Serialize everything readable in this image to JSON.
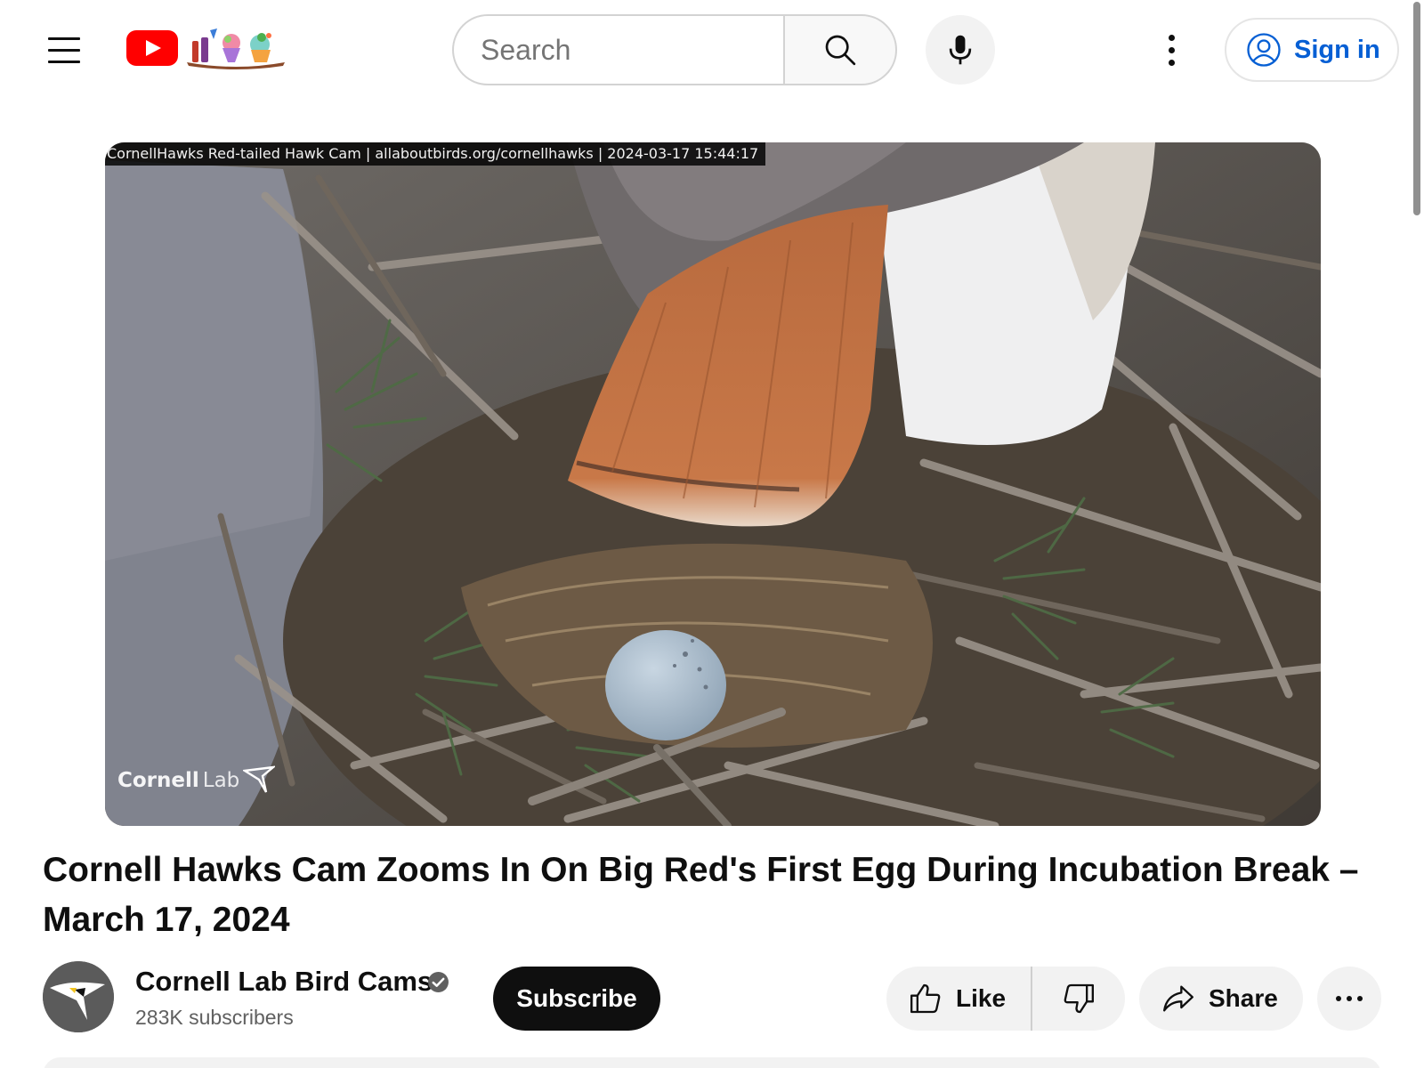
{
  "header": {
    "search_placeholder": "Search",
    "sign_in_label": "Sign in"
  },
  "player": {
    "overlay_caption": "CornellHawks Red-tailed Hawk Cam | allaboutbirds.org/cornellhawks | 2024-03-17 15:44:17",
    "watermark_part1": "Cornell",
    "watermark_part2": "Lab"
  },
  "video": {
    "title": "Cornell Hawks Cam Zooms In On Big Red's First Egg During Incubation Break – March 17, 2024"
  },
  "owner": {
    "channel_name": "Cornell Lab Bird Cams",
    "subscribers": "283K subscribers",
    "subscribe_label": "Subscribe"
  },
  "actions": {
    "like_label": "Like",
    "share_label": "Share"
  },
  "colors": {
    "brand_red": "#ff0000",
    "link_blue": "#065fd4",
    "pill_bg": "#f2f2f2",
    "text": "#0f0f0f",
    "secondary_text": "#606060"
  },
  "icons": [
    "menu-icon",
    "youtube-logo",
    "search-icon",
    "mic-icon",
    "more-vert-icon",
    "account-icon",
    "verified-icon",
    "like-icon",
    "dislike-icon",
    "share-icon",
    "more-horiz-icon"
  ]
}
